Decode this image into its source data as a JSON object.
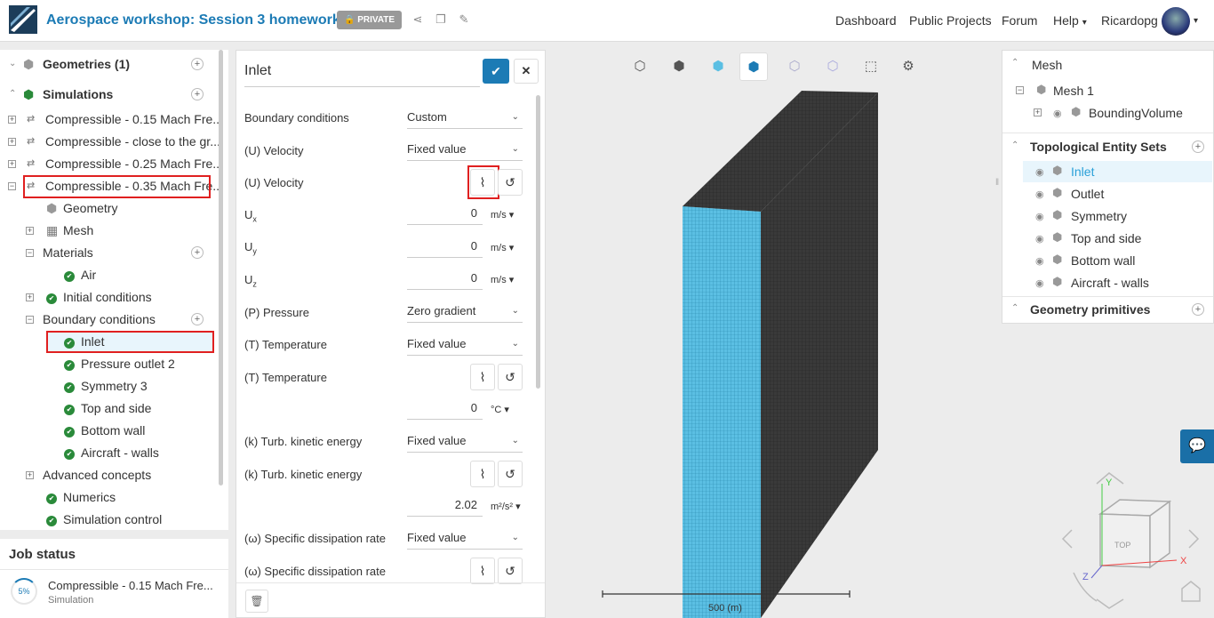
{
  "header": {
    "title": "Aerospace workshop: Session 3 homework",
    "privacy": "PRIVATE",
    "nav": [
      "Dashboard",
      "Public Projects",
      "Forum",
      "Help",
      "Ricardopg"
    ]
  },
  "tree": {
    "geometries": "Geometries (1)",
    "simulations": "Simulations",
    "sims": [
      "Compressible - 0.15 Mach Fre...",
      "Compressible - close to the gr...",
      "Compressible - 0.25 Mach Fre...",
      "Compressible - 0.35 Mach Fre..."
    ],
    "geometry": "Geometry",
    "mesh": "Mesh",
    "materials": "Materials",
    "air": "Air",
    "initial": "Initial conditions",
    "boundary": "Boundary conditions",
    "bcs": [
      "Inlet",
      "Pressure outlet 2",
      "Symmetry 3",
      "Top and side",
      "Bottom wall",
      "Aircraft - walls"
    ],
    "advanced": "Advanced concepts",
    "numerics": "Numerics",
    "simctl": "Simulation control"
  },
  "job": {
    "title": "Job status",
    "progress": "5%",
    "progress_value": 5,
    "name": "Compressible - 0.15 Mach Fre...",
    "type": "Simulation"
  },
  "form": {
    "name": "Inlet",
    "bc_label": "Boundary conditions",
    "bc_value": "Custom",
    "vel_label": "(U) Velocity",
    "vel_value": "Fixed value",
    "vel2_label": "(U) Velocity",
    "ux": "0",
    "uy": "0",
    "uz": "0",
    "unit_ms": "m/s",
    "p_label": "(P) Pressure",
    "p_value": "Zero gradient",
    "t_label": "(T) Temperature",
    "t_value": "Fixed value",
    "t2_label": "(T) Temperature",
    "t_num": "0",
    "t_unit": "°C",
    "k_label": "(k) Turb. kinetic energy",
    "k_value": "Fixed value",
    "k2_label": "(k) Turb. kinetic energy",
    "k_num": "2.02",
    "k_unit": "m²/s²",
    "w_label": "(ω) Specific dissipation rate",
    "w_value": "Fixed value",
    "w2_label": "(ω) Specific dissipation rate"
  },
  "rightpanel": {
    "mesh": "Mesh",
    "mesh1": "Mesh 1",
    "bounding": "BoundingVolume",
    "topo": "Topological Entity Sets",
    "sets": [
      "Inlet",
      "Outlet",
      "Symmetry",
      "Top and side",
      "Bottom wall",
      "Aircraft - walls"
    ],
    "prims": "Geometry primitives"
  },
  "viewport": {
    "scale": "500 (m)",
    "cube_top": "TOP"
  },
  "colors": {
    "accent": "#1c7bb5",
    "green": "#2a8a3a",
    "red": "#e02020",
    "mesh_blue": "#5bbfe3"
  }
}
